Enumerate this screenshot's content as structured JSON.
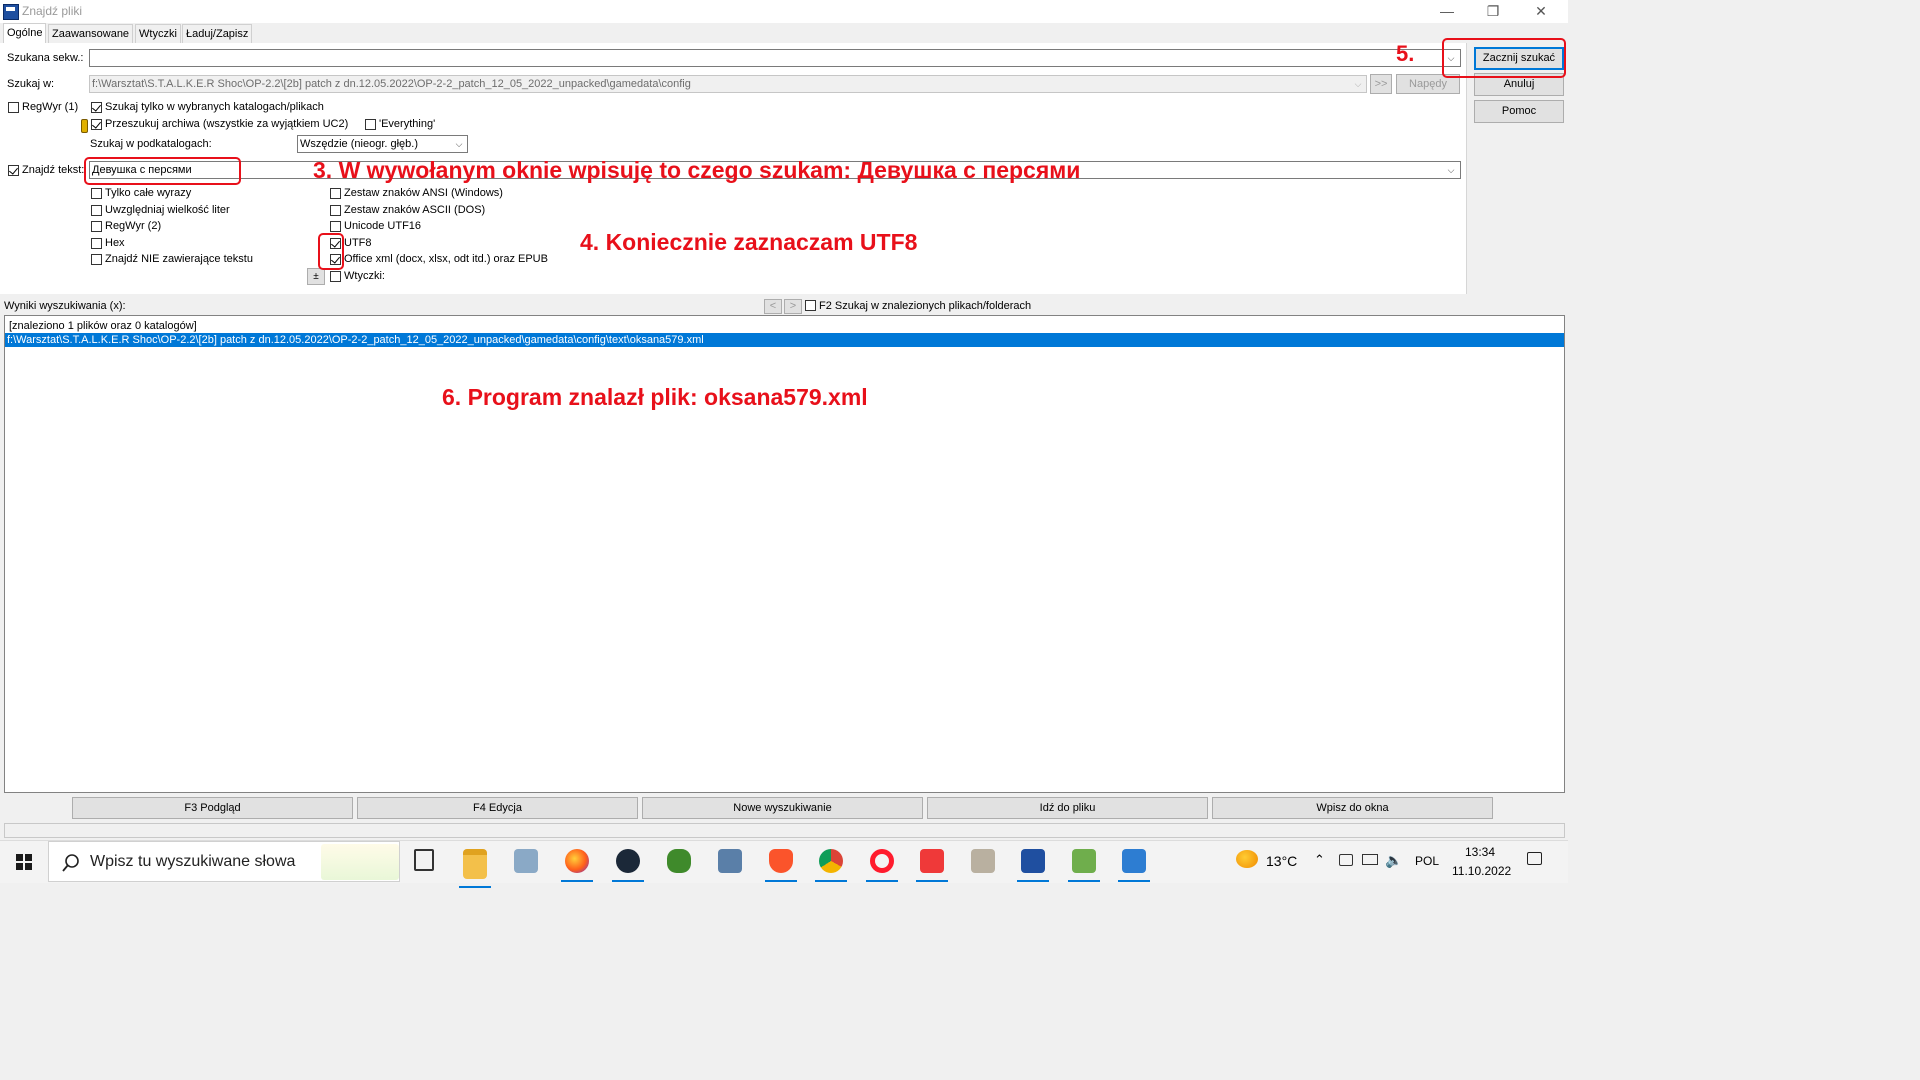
{
  "window": {
    "title": "Znajdź pliki",
    "minimize_glyph": "—",
    "restore_glyph": "❐",
    "close_glyph": "✕"
  },
  "tabs": [
    {
      "label": "Ogólne",
      "active": true
    },
    {
      "label": "Zaawansowane",
      "active": false
    },
    {
      "label": "Wtyczki",
      "active": false
    },
    {
      "label": "Ładuj/Zapisz",
      "active": false
    }
  ],
  "search": {
    "mask_label": "Szukana sekw.:",
    "mask_value": "",
    "search_in_label": "Szukaj w:",
    "search_in_value": "f:\\Warsztat\\S.T.A.L.K.E.R Shoc\\OP-2.2\\[2b] patch z dn.12.05.2022\\OP-2-2_patch_12_05_2022_unpacked\\gamedata\\config",
    "browse_label": ">>",
    "drives_label": "Napędy",
    "regex1_label": "RegWyr (1)",
    "only_selected_label": "Szukaj tylko w wybranych katalogach/plikach",
    "archives_label": "Przeszukuj archiwa (wszystkie za wyjątkiem UC2)",
    "everything_label": "'Everything'",
    "subdirs_label": "Szukaj w podkatalogach:",
    "subdirs_value": "Wszędzie (nieogr. głęb.)"
  },
  "find_text": {
    "label": "Znajdź tekst:",
    "value": "Девушка с персями",
    "options_left": [
      {
        "label": "Tylko całe wyrazy",
        "checked": false
      },
      {
        "label": "Uwzględniaj wielkość liter",
        "checked": false
      },
      {
        "label": "RegWyr (2)",
        "checked": false
      },
      {
        "label": "Hex",
        "checked": false
      },
      {
        "label": "Znajdź NIE zawierające tekstu",
        "checked": false
      }
    ],
    "options_right": [
      {
        "label": "Zestaw znaków ANSI (Windows)",
        "checked": false
      },
      {
        "label": "Zestaw znaków ASCII (DOS)",
        "checked": false
      },
      {
        "label": "Unicode UTF16",
        "checked": false
      },
      {
        "label": "UTF8",
        "checked": true
      },
      {
        "label": "Office xml (docx, xlsx, odt itd.) oraz EPUB",
        "checked": true
      },
      {
        "label": "Wtyczki:",
        "checked": false
      }
    ],
    "plus_label": "±"
  },
  "side_buttons": {
    "start": "Zacznij szukać",
    "cancel": "Anuluj",
    "help": "Pomoc"
  },
  "results": {
    "label": "Wyniki wyszukiwania (x):",
    "prev": "<",
    "next": ">",
    "f2_label": "F2 Szukaj w znalezionych plikach/folderach",
    "summary": "[znaleziono 1 plików oraz 0 katalogów]",
    "items": [
      "f:\\Warsztat\\S.T.A.L.K.E.R Shoc\\OP-2.2\\[2b] patch z dn.12.05.2022\\OP-2-2_patch_12_05_2022_unpacked\\gamedata\\config\\text\\oksana579.xml"
    ]
  },
  "bottom_buttons": [
    "F3 Podgląd",
    "F4 Edycja",
    "Nowe wyszukiwanie",
    "Idź do pliku",
    "Wpisz do okna"
  ],
  "annotations": {
    "step3": "3. W wywołanym oknie wpisuję to czego szukam:  Девушка с персями",
    "step4": "4. Koniecznie zaznaczam UTF8",
    "step5": "5.",
    "step6": "6. Program znalazł plik:  oksana579.xml"
  },
  "taskbar": {
    "search_placeholder": "Wpisz tu wyszukiwane słowa",
    "weather": "13°C",
    "language": "POL",
    "time": "13:34",
    "date": "11.10.2022",
    "apps": [
      "task-view-icon",
      "file-explorer-icon",
      "network-app-icon",
      "firefox-icon",
      "steam-icon",
      "game-app-icon",
      "calculator-icon",
      "brave-icon",
      "chrome-icon",
      "opera-icon",
      "vivaldi-icon",
      "gimp-icon",
      "save-app-icon",
      "notepad-app-icon",
      "photos-icon"
    ]
  },
  "colors": {
    "accent": "#0078d7",
    "annotation": "#e8101a",
    "selection": "#0078d7"
  }
}
